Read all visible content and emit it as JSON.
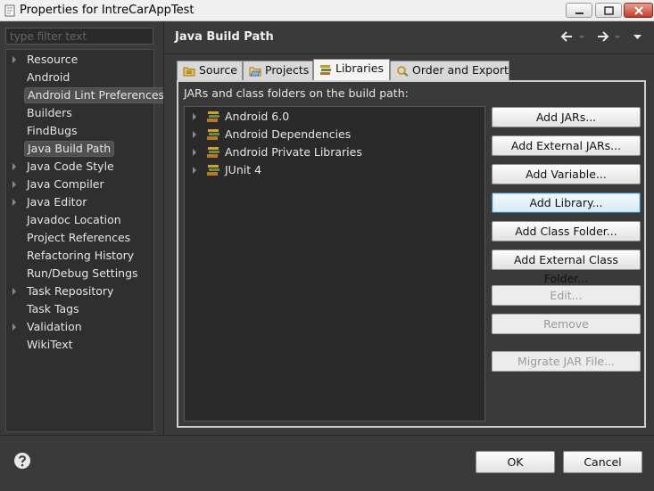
{
  "window": {
    "title": "Properties for IntreCarAppTest"
  },
  "sidebar": {
    "filter_placeholder": "type filter text",
    "items": [
      {
        "label": "Resource",
        "expandable": true,
        "selected": false
      },
      {
        "label": "Android",
        "expandable": false,
        "selected": false
      },
      {
        "label": "Android Lint Preferences",
        "expandable": false,
        "selected": true
      },
      {
        "label": "Builders",
        "expandable": false,
        "selected": false
      },
      {
        "label": "FindBugs",
        "expandable": false,
        "selected": false
      },
      {
        "label": "Java Build Path",
        "expandable": false,
        "selected": true
      },
      {
        "label": "Java Code Style",
        "expandable": true,
        "selected": false
      },
      {
        "label": "Java Compiler",
        "expandable": true,
        "selected": false
      },
      {
        "label": "Java Editor",
        "expandable": true,
        "selected": false
      },
      {
        "label": "Javadoc Location",
        "expandable": false,
        "selected": false
      },
      {
        "label": "Project References",
        "expandable": false,
        "selected": false
      },
      {
        "label": "Refactoring History",
        "expandable": false,
        "selected": false
      },
      {
        "label": "Run/Debug Settings",
        "expandable": false,
        "selected": false
      },
      {
        "label": "Task Repository",
        "expandable": true,
        "selected": false
      },
      {
        "label": "Task Tags",
        "expandable": false,
        "selected": false
      },
      {
        "label": "Validation",
        "expandable": true,
        "selected": false
      },
      {
        "label": "WikiText",
        "expandable": false,
        "selected": false
      }
    ]
  },
  "page": {
    "title": "Java Build Path",
    "tabs": [
      {
        "label": "Source",
        "icon": "source-folder-icon",
        "active": false
      },
      {
        "label": "Projects",
        "icon": "projects-icon",
        "active": false
      },
      {
        "label": "Libraries",
        "icon": "libraries-icon",
        "active": true
      },
      {
        "label": "Order and Export",
        "icon": "order-export-icon",
        "active": false
      }
    ],
    "libraries_header": "JARs and class folders on the build path:",
    "libraries": [
      {
        "label": "Android 6.0"
      },
      {
        "label": "Android Dependencies"
      },
      {
        "label": "Android Private Libraries"
      },
      {
        "label": "JUnit 4"
      }
    ],
    "buttons": [
      {
        "label": "Add JARs...",
        "state": "normal"
      },
      {
        "label": "Add External JARs...",
        "state": "normal"
      },
      {
        "label": "Add Variable...",
        "state": "normal"
      },
      {
        "label": "Add Library...",
        "state": "focus"
      },
      {
        "label": "Add Class Folder...",
        "state": "normal"
      },
      {
        "label": "Add External Class Folder...",
        "state": "normal"
      },
      {
        "label": "Edit...",
        "state": "disabled"
      },
      {
        "label": "Remove",
        "state": "disabled"
      },
      {
        "label": "Migrate JAR File...",
        "state": "disabled"
      }
    ]
  },
  "footer": {
    "ok_label": "OK",
    "cancel_label": "Cancel"
  },
  "colors": {
    "background": "#3a3a3a",
    "tree_background": "#2a2a2a",
    "focus_border": "#3c7fb1",
    "close_button": "#c43b2a"
  }
}
